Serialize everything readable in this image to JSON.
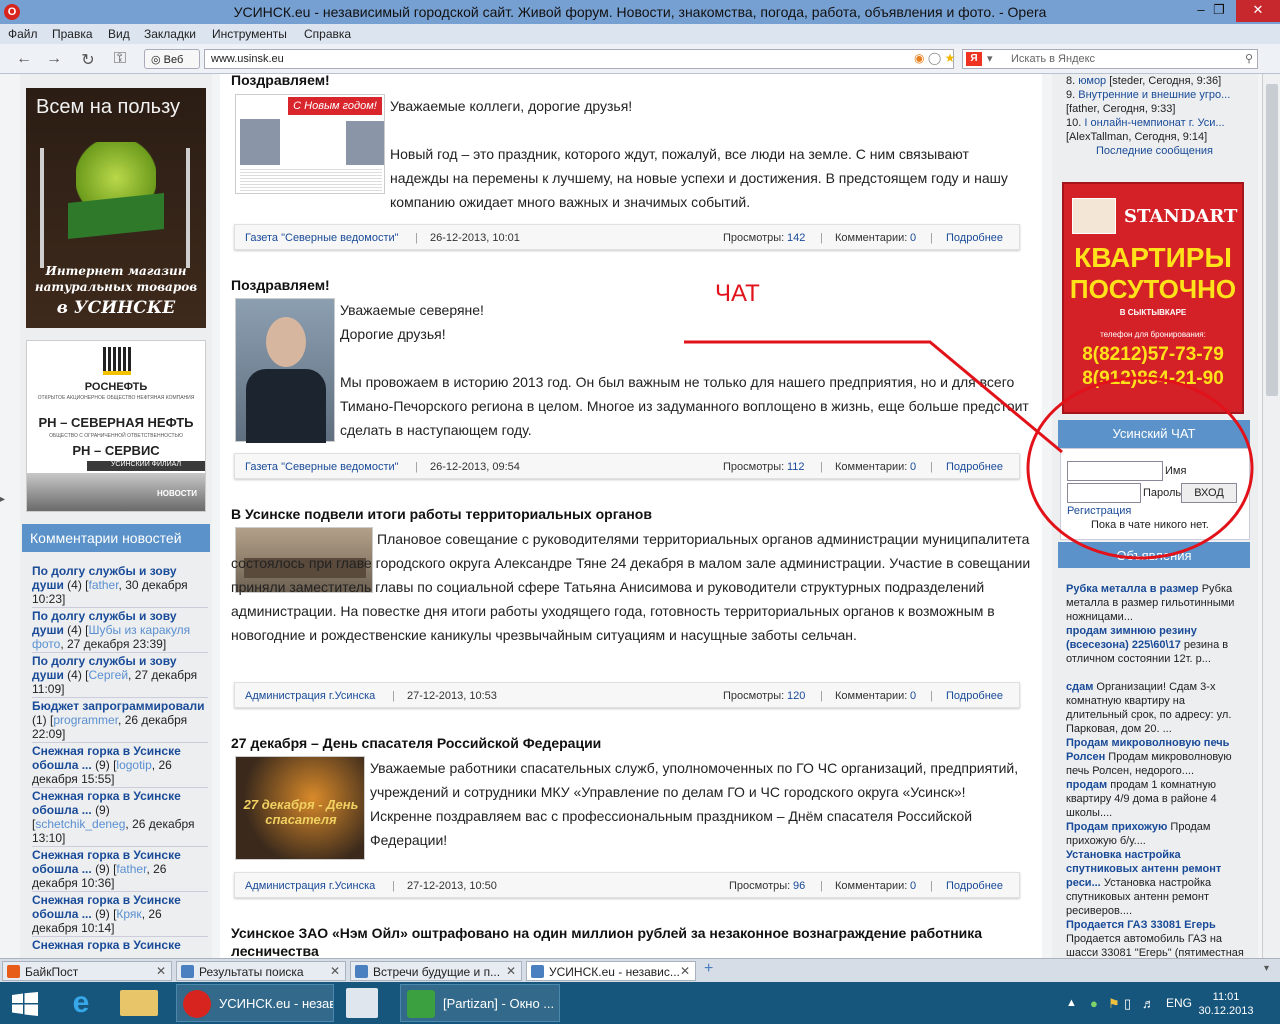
{
  "window": {
    "title": "УСИНСК.eu - независимый городской сайт. Живой форум. Новости, знакомства, погода, работа, объявления и фото. - Opera",
    "app_icon": "opera-icon",
    "controls": [
      "minimize-icon",
      "restore-icon",
      "close-icon"
    ]
  },
  "menu": [
    "Файл",
    "Правка",
    "Вид",
    "Закладки",
    "Инструменты",
    "Справка"
  ],
  "nav": {
    "web_label": "Веб",
    "url": "www.usinsk.eu",
    "search_placeholder": "Искать в Яндекс",
    "search_engine_badge": "Я"
  },
  "left": {
    "ad1": {
      "line1": "Всем на пользу",
      "caption1": "Интернет магазин",
      "caption2": "натуральных товаров",
      "caption3": "в УСИНСКЕ"
    },
    "ad2": {
      "brand": "РОСНЕФТЬ",
      "sub": "ОТКРЫТОЕ АКЦИОНЕРНОЕ ОБЩЕСТВО НЕФТЯНАЯ КОМПАНИЯ",
      "name1": "РН – СЕВЕРНАЯ НЕФТЬ",
      "sub2": "ОБЩЕСТВО С ОГРАНИЧЕННОЙ ОТВЕТСТВЕННОСТЬЮ",
      "name2": "РН – СЕРВИС",
      "sub3": "УСИНСКИЙ ФИЛИАЛ",
      "tag": "НОВОСТИ"
    },
    "comments_header": "Комментарии новостей",
    "comments": [
      {
        "title": "По долгу службы и зову души",
        "count": "(4)",
        "user": "father",
        "date": "30 декабря 10:23"
      },
      {
        "title": "По долгу службы и зову души",
        "count": "(4)",
        "user": "Шубы из каракуля фото",
        "date": "27 декабря 23:39"
      },
      {
        "title": "По долгу службы и зову души",
        "count": "(4)",
        "user": "Сергей",
        "date": "27 декабря 11:09"
      },
      {
        "title": "Бюджет запрограммировали",
        "count": "(1)",
        "user": "programmer",
        "date": "26 декабря 22:09"
      },
      {
        "title": "Снежная горка в Усинске обошла ...",
        "count": "(9)",
        "user": "logotip",
        "date": "26 декабря 15:55"
      },
      {
        "title": "Снежная горка в Усинске обошла ...",
        "count": "(9)",
        "user": "schetchik_deneg",
        "date": "26 декабря 13:10"
      },
      {
        "title": "Снежная горка в Усинске обошла ...",
        "count": "(9)",
        "user": "father",
        "date": "26 декабря 10:36"
      },
      {
        "title": "Снежная горка в Усинске обошла ...",
        "count": "(9)",
        "user": "Кряк",
        "date": "26 декабря 10:14"
      },
      {
        "title": "Снежная горка в Усинске",
        "count": "",
        "user": "",
        "date": ""
      }
    ]
  },
  "articles": [
    {
      "title": "Поздравляем!",
      "thumb_text": "С Новым годом!",
      "paragraphs": [
        "Уважаемые коллеги, дорогие друзья!",
        "Новый год – это праздник, которого ждут, пожалуй, все люди на земле. С ним связывают надежды на перемены к лучшему, на новые успехи и достижения. В предстоящем году и нашу компанию ожидает много важных и значимых событий."
      ],
      "source": "Газета \"Северные ведомости\"",
      "date": "26-12-2013, 10:01",
      "views_label": "Просмотры:",
      "views": "142",
      "comments_label": "Комментарии:",
      "comments": "0",
      "more": "Подробнее"
    },
    {
      "title": "Поздравляем!",
      "paragraphs": [
        "Уважаемые северяне!",
        "Дорогие друзья!",
        "Мы провожаем в историю 2013 год. Он был важным не только для нашего предприятия, но и для всего Тимано-Печорского региона в целом. Многое из задуманного воплощено в жизнь, еще больше предстоит сделать в наступающем году."
      ],
      "source": "Газета \"Северные ведомости\"",
      "date": "26-12-2013, 09:54",
      "views_label": "Просмотры:",
      "views": "112",
      "comments_label": "Комментарии:",
      "comments": "0",
      "more": "Подробнее"
    },
    {
      "title": "В Усинске подвели итоги работы территориальных органов",
      "paragraphs": [
        "Плановое совещание с руководителями территориальных органов администрации муниципалитета состоялось при главе городского округа Александре Тяне 24 декабря в малом зале администрации. Участие в совещании приняли заместитель главы по социальной сфере Татьяна Анисимова и руководители структурных подразделений администрации. На повестке дня итоги работы уходящего года, готовность территориальных органов к возможным в новогодние и рождественские каникулы чрезвычайным ситуациям и насущные заботы сельчан."
      ],
      "source": "Администрация г.Усинска",
      "date": "27-12-2013, 10:53",
      "views_label": "Просмотры:",
      "views": "120",
      "comments_label": "Комментарии:",
      "comments": "0",
      "more": "Подробнее"
    },
    {
      "title": "27 декабря – День спасателя Российской Федерации",
      "thumb_text": "27 декабря - День спасателя",
      "paragraphs": [
        "Уважаемые работники спасательных служб, уполномоченных по ГО ЧС организаций, предприятий, учреждений и сотрудники МКУ «Управление по делам ГО и ЧС городского округа «Усинск»! Искренне поздравляем вас с профессиональным праздником – Днём спасателя Российской Федерации!"
      ],
      "source": "Администрация г.Усинска",
      "date": "27-12-2013, 10:50",
      "views_label": "Просмотры:",
      "views": "96",
      "comments_label": "Комментарии:",
      "comments": "0",
      "more": "Подробнее"
    },
    {
      "title": "Усинское ЗАО «Нэм Ойл» оштрафовано на один миллион рублей за незаконное вознаграждение работника лесничества"
    }
  ],
  "right": {
    "forum_top": [
      {
        "n": "8.",
        "title": "юмор",
        "meta": "[steder, Сегодня, 9:36]"
      },
      {
        "n": "9.",
        "title": "Внутренние и внешние угро...",
        "meta": "[father, Сегодня, 9:33]"
      },
      {
        "n": "10.",
        "title": "I онлайн-чемпионат г. Уси...",
        "meta": "[AlexTallman, Сегодня, 9:14]"
      }
    ],
    "last_posts": "Последние сообщения",
    "ad": {
      "brand": "STANDART",
      "l1": "КВАРТИРЫ",
      "l2": "ПОСУТОЧНО",
      "l3": "В СЫКТЫВКАРЕ",
      "l4": "телефон для бронирования:",
      "phone1": "8(8212)57-73-79",
      "phone2": "8(912)864-21-90"
    },
    "chat": {
      "header": "Усинский ЧАТ",
      "name_label": "Имя",
      "pass_label": "Пароль",
      "login": "ВХОД",
      "register": "Регистрация",
      "status": "Пока в чате никого нет."
    },
    "ads_header": "Объявления",
    "ads": [
      {
        "title": "Рубка металла в размер",
        "text": "Рубка металла в размер гильотинными ножницами..."
      },
      {
        "title": "продам зимнюю резину (всесезона) 225\\60\\17",
        "text": "резина в отличном состоянии 12т. р..."
      },
      {
        "title": "сдам",
        "text": "Организации! Сдам 3-х комнатную квартиру на длительный срок, по адресу: ул. Парковая, дом 20. ..."
      },
      {
        "title": "Продам микроволновую печь Ролсен",
        "text": "Продам микроволновую печь Ролсен, недорого...."
      },
      {
        "title": "продам",
        "text": "продам 1 комнатную квартиру 4/9 дома в районе 4 школы...."
      },
      {
        "title": "Продам прихожую",
        "text": "Продам прихожую б/у...."
      },
      {
        "title": "Установка настройка спутниковых антенн ремонт реси...",
        "text": "Установка настройка спутниковых антенн ремонт ресиверов...."
      },
      {
        "title": "Продается ГАЗ 33081 Егерь",
        "text": "Продается автомобиль ГАЗ на шасси 33081 \"Егерь\" (пятиместная"
      }
    ]
  },
  "annotation": {
    "label": "ЧАТ",
    "color": "#e1121a"
  },
  "tabs": [
    {
      "label": "БайкПост"
    },
    {
      "label": "Результаты поиска"
    },
    {
      "label": "Встречи будущие и п..."
    },
    {
      "label": "УСИНСК.eu - независ..."
    }
  ],
  "taskbar": {
    "items": [
      {
        "label": "УСИНСК.eu - незав..."
      },
      {
        "label": "[Partizan] - Окно ..."
      }
    ],
    "lang": "ENG",
    "time": "11:01",
    "date": "30.12.2013"
  }
}
